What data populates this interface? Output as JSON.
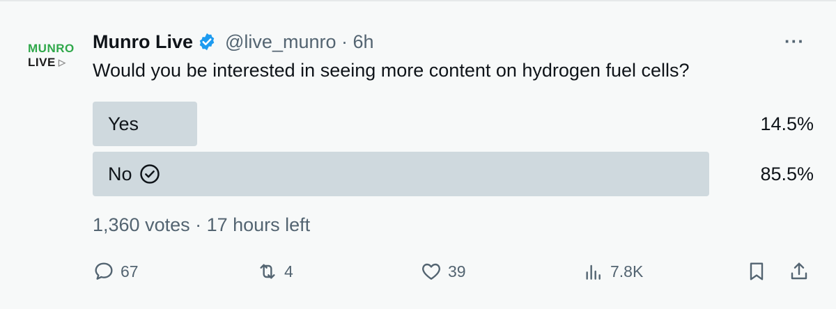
{
  "account": {
    "avatar_line1": "MUNRO",
    "avatar_line2": "LIVE",
    "avatar_play": "▷",
    "name": "Munro Live",
    "handle": "@live_munro · 6h"
  },
  "post": {
    "question": "Would you be interested in seeing more content on hydrogen fuel cells?"
  },
  "poll": {
    "options": [
      {
        "label": "Yes",
        "percent_text": "14.5%",
        "percent": 14.5,
        "selected": false
      },
      {
        "label": "No",
        "percent_text": "85.5%",
        "percent": 85.5,
        "selected": true
      }
    ],
    "summary": "1,360 votes · 17 hours left"
  },
  "actions": {
    "replies": "67",
    "reposts": "4",
    "likes": "39",
    "views": "7.8K"
  },
  "colors": {
    "verified": "#1d9bf0",
    "bar": "#cfd9de",
    "muted": "#536471"
  },
  "icons": [
    "verified-badge-icon",
    "more-icon",
    "check-circle-icon",
    "reply-icon",
    "repost-icon",
    "like-icon",
    "views-icon",
    "bookmark-icon",
    "share-icon"
  ]
}
